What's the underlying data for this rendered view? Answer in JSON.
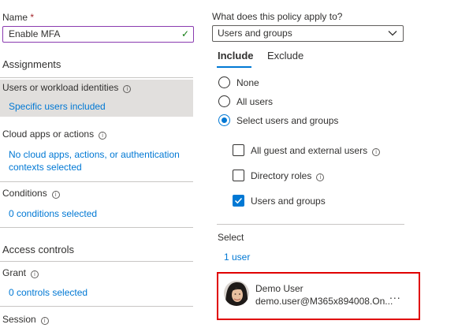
{
  "left": {
    "name_label": "Name",
    "required_mark": "*",
    "name_value": "Enable MFA",
    "assignments_heading": "Assignments",
    "users_label": "Users or workload identities",
    "users_value": "Specific users included",
    "cloud_label": "Cloud apps or actions",
    "cloud_value_line1": "No cloud apps, actions, or authentication",
    "cloud_value_line2": "contexts selected",
    "conditions_label": "Conditions",
    "conditions_value": "0 conditions selected",
    "access_heading": "Access controls",
    "grant_label": "Grant",
    "grant_value": "0 controls selected",
    "session_label": "Session"
  },
  "right": {
    "policy_question": "What does this policy apply to?",
    "policy_value": "Users and groups",
    "tabs": [
      "Include",
      "Exclude"
    ],
    "radios": [
      {
        "label": "None",
        "selected": false
      },
      {
        "label": "All users",
        "selected": false
      },
      {
        "label": "Select users and groups",
        "selected": true
      }
    ],
    "checkboxes": [
      {
        "label": "All guest and external users",
        "checked": false,
        "info": true
      },
      {
        "label": "Directory roles",
        "checked": false,
        "info": true
      },
      {
        "label": "Users and groups",
        "checked": true,
        "info": false
      }
    ],
    "select_heading": "Select",
    "select_count": "1 user",
    "user": {
      "name": "Demo User",
      "email": "demo.user@M365x894008.On...",
      "more": "..."
    }
  },
  "colors": {
    "accent": "#0078d4",
    "highlight_border": "#e00000",
    "required": "#a4262c",
    "valid_check": "#107c10",
    "selected_block": "#e1dfdd"
  }
}
